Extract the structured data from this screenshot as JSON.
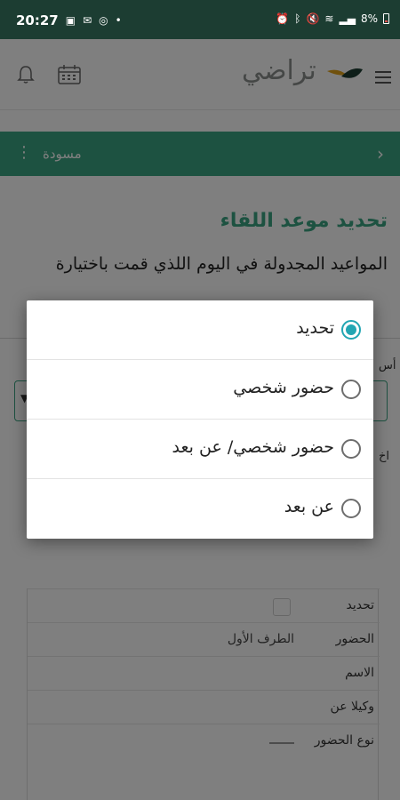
{
  "status_bar": {
    "time": "20:27",
    "battery": "8%",
    "icons": [
      "image-icon",
      "mail-icon",
      "whatsapp-icon",
      "dot-icon",
      "alarm-icon",
      "bluetooth-icon",
      "mute-icon",
      "wifi-icon",
      "signal-icon",
      "battery-icon"
    ]
  },
  "app_bar": {
    "logo_text": "تراضي",
    "icons": [
      "bell-icon",
      "calendar-icon",
      "menu-icon"
    ]
  },
  "draft_bar": {
    "label": "مسودة",
    "icons": [
      "more-vertical-icon",
      "chevron-right-icon"
    ]
  },
  "page": {
    "title": "تحديد موعد اللقاء",
    "description": "المواعيد المجدولة في اليوم اللذي قمت باختيارة",
    "side_fragment_1": "أس",
    "side_fragment_2": "اخ"
  },
  "table": {
    "rows": [
      {
        "label": "تحديد",
        "value": ""
      },
      {
        "label": "الحضور",
        "value": "الطرف الأول"
      },
      {
        "label": "الاسم",
        "value": ""
      },
      {
        "label": "وكيلا عن",
        "value": ""
      },
      {
        "label": "نوع الحضور",
        "value": ""
      }
    ]
  },
  "dialog": {
    "options": [
      {
        "label": "تحديد",
        "selected": true
      },
      {
        "label": "حضور شخصي",
        "selected": false
      },
      {
        "label": "حضور شخصي/ عن بعد",
        "selected": false
      },
      {
        "label": "عن بعد",
        "selected": false
      }
    ]
  },
  "colors": {
    "status_bar": "#1c3d32",
    "accent_green": "#3aa582",
    "radio_selected": "#22a6b3",
    "overlay": "rgba(0,0,0,0.5)"
  }
}
